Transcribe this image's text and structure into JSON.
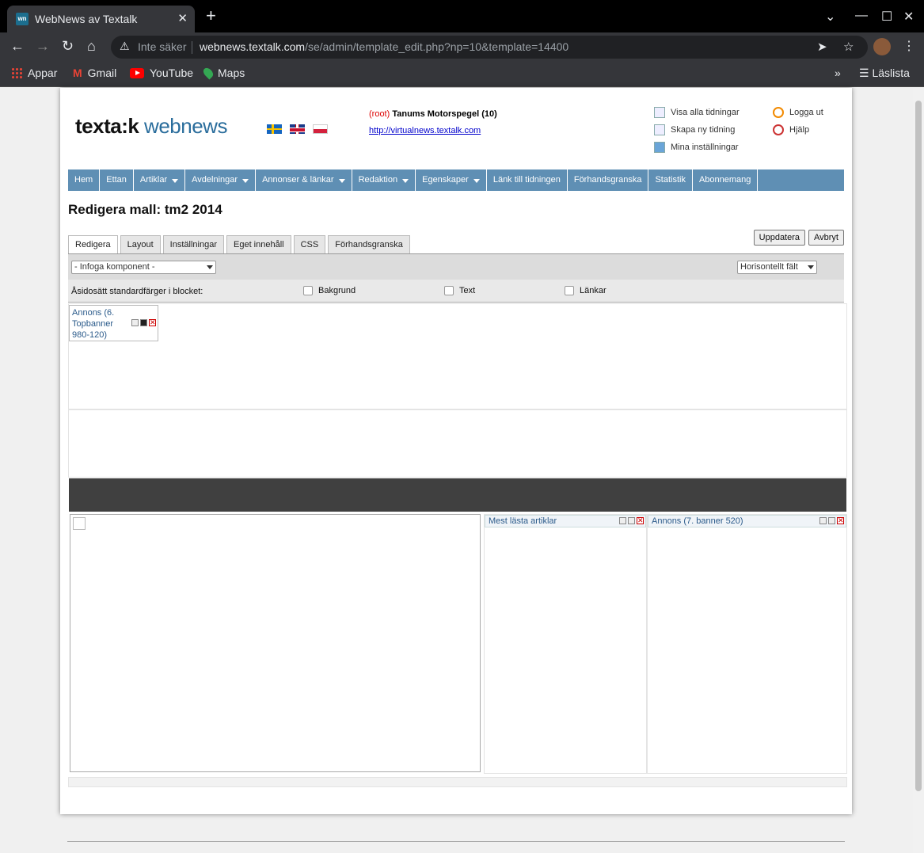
{
  "browser": {
    "tab_title": "WebNews av Textalk",
    "tab_favicon": "wn",
    "new_tab": "+",
    "close_tab": "✕",
    "security_warning": "Inte säker",
    "url_host": "webnews.textalk.com",
    "url_path": "/se/admin/template_edit.php?np=10&template=14400",
    "bookmarks": [
      {
        "label": "Appar",
        "icon": "apps-grid-icon"
      },
      {
        "label": "Gmail",
        "icon": "gmail-icon"
      },
      {
        "label": "YouTube",
        "icon": "youtube-icon"
      },
      {
        "label": "Maps",
        "icon": "maps-icon"
      }
    ],
    "reading_list": "Läslista",
    "more_bookmarks": "»"
  },
  "header": {
    "logo_part1": "texta:k",
    "logo_part2": " webnews",
    "root_tag": "(root)",
    "paper_name": "Tanums Motorspegel (10)",
    "paper_url": "http://virtualnews.textalk.com",
    "quick_links": [
      {
        "label": "Visa alla tidningar",
        "icon": "list-icon"
      },
      {
        "label": "Skapa ny tidning",
        "icon": "new-paper-icon"
      },
      {
        "label": "Mina inställningar",
        "icon": "user-settings-icon"
      },
      {
        "label": "Logga ut",
        "icon": "power-icon"
      },
      {
        "label": "Hjälp",
        "icon": "help-icon"
      }
    ]
  },
  "menu": [
    {
      "label": "Hem",
      "dropdown": false
    },
    {
      "label": "Ettan",
      "dropdown": false
    },
    {
      "label": "Artiklar",
      "dropdown": true
    },
    {
      "label": "Avdelningar",
      "dropdown": true
    },
    {
      "label": "Annonser & länkar",
      "dropdown": true
    },
    {
      "label": "Redaktion",
      "dropdown": true
    },
    {
      "label": "Egenskaper",
      "dropdown": true
    },
    {
      "label": "Länk till tidningen",
      "dropdown": false
    },
    {
      "label": "Förhandsgranska",
      "dropdown": false
    },
    {
      "label": "Statistik",
      "dropdown": false
    },
    {
      "label": "Abonnemang",
      "dropdown": false
    }
  ],
  "page_title": "Redigera mall: tm2 2014",
  "tabs": [
    "Redigera",
    "Layout",
    "Inställningar",
    "Eget innehåll",
    "CSS",
    "Förhandsgranska"
  ],
  "active_tab": "Redigera",
  "actions": {
    "update": "Uppdatera",
    "cancel": "Avbryt"
  },
  "toolrow": {
    "insert_component": "- Infoga komponent -",
    "orientation": "Horisontellt fält"
  },
  "colorrow": {
    "label": "Åsidosätt standardfärger i blocket:",
    "background": "Bakgrund",
    "text": "Text",
    "links": "Länkar"
  },
  "components": {
    "top_banner_line1": "Annons (6.",
    "top_banner_line2": "Topbanner",
    "top_banner_line3": "980-120)",
    "most_read": "Mest lästa artiklar",
    "banner_520": "Annons (7. banner 520)"
  },
  "colors": {
    "menu_bg": "#5f8fb4",
    "logo_blue": "#2a6d9c",
    "dark_bar": "#404040",
    "root_red": "#dd0000"
  }
}
